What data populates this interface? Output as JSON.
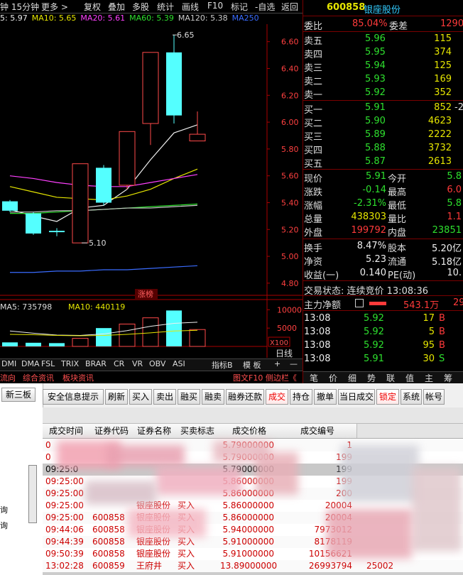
{
  "toolbar": {
    "period": "钟 15分钟",
    "more": "更多 >",
    "buttons": [
      "复权",
      "叠加",
      "多股",
      "统计",
      "画线",
      "F10",
      "标记",
      "-自选",
      "返回"
    ]
  },
  "ma_legend": {
    "ma5": "5: 5.97",
    "ma10": "MA10: 5.65",
    "ma20": "MA20: 5.61",
    "ma60": "MA60: 5.39",
    "ma120": "MA120: 5.38",
    "ma250": "MA250"
  },
  "chart_data": {
    "type": "candlestick",
    "y_ticks": [
      "6.60",
      "6.40",
      "6.20",
      "6.00",
      "5.80",
      "5.60",
      "5.40",
      "5.20",
      "5.00",
      "4.80"
    ],
    "ylim": [
      4.72,
      6.72
    ],
    "annotations": {
      "high": "6.65",
      "low": "5.10",
      "label": "涨榜"
    },
    "candles": [
      {
        "open": 5.34,
        "close": 5.41,
        "high": 5.42,
        "low": 5.33,
        "dir": "down"
      },
      {
        "open": 5.32,
        "close": 5.17,
        "high": 5.33,
        "low": 5.16,
        "dir": "down"
      },
      {
        "open": 5.19,
        "close": 5.18,
        "high": 5.21,
        "low": 5.15,
        "dir": "down"
      },
      {
        "open": 5.1,
        "close": 5.69,
        "high": 5.69,
        "low": 5.1,
        "dir": "up"
      },
      {
        "open": 5.66,
        "close": 5.4,
        "high": 5.68,
        "low": 5.38,
        "dir": "down"
      },
      {
        "open": 5.53,
        "close": 5.93,
        "high": 5.93,
        "low": 5.5,
        "dir": "up"
      },
      {
        "open": 5.99,
        "close": 6.52,
        "high": 6.52,
        "low": 5.83,
        "dir": "up"
      },
      {
        "open": 6.52,
        "close": 6.05,
        "high": 6.65,
        "low": 5.99,
        "dir": "down"
      },
      {
        "open": 5.86,
        "close": 5.91,
        "high": 6.08,
        "low": 5.86,
        "dir": "up"
      }
    ],
    "volume": {
      "legend_ma5": "MA5: 735798",
      "legend_ma10": "MA10: 440119",
      "y_ticks": [
        "10000",
        "5000"
      ],
      "unit": "X100",
      "values": [
        1100,
        1000,
        900,
        2200,
        5000,
        6100,
        7800,
        9800,
        4600
      ],
      "ylim": [
        0,
        12000
      ]
    }
  },
  "chart_tabs": {
    "indicators": [
      "DMI",
      "DMA",
      "FSL",
      "TRIX",
      "BRAR",
      "CR",
      "VR",
      "OBV",
      "ASI"
    ],
    "extras": [
      "指标B",
      "模 板",
      "+",
      "—"
    ],
    "right_label": "日线",
    "row2": [
      "流向",
      "综合资讯",
      "板块资讯"
    ],
    "row2_right": "图文F10 侧边栏《"
  },
  "quote": {
    "code": "600858",
    "name": "银座股份",
    "weibi_label": "委比",
    "weibi_value": "85.04%",
    "weicha_label": "委差",
    "weicha_value": "1290",
    "asks": [
      {
        "label": "卖五",
        "price": "5.96",
        "vol": "115"
      },
      {
        "label": "卖四",
        "price": "5.95",
        "vol": "374"
      },
      {
        "label": "卖三",
        "price": "5.94",
        "vol": "125"
      },
      {
        "label": "卖二",
        "price": "5.93",
        "vol": "169"
      },
      {
        "label": "卖一",
        "price": "5.92",
        "vol": "352"
      }
    ],
    "bids": [
      {
        "label": "买一",
        "price": "5.91",
        "vol": "852",
        "extra": "-2"
      },
      {
        "label": "买二",
        "price": "5.90",
        "vol": "4623"
      },
      {
        "label": "买三",
        "price": "5.89",
        "vol": "2222"
      },
      {
        "label": "买四",
        "price": "5.88",
        "vol": "3732"
      },
      {
        "label": "买五",
        "price": "5.87",
        "vol": "2613"
      }
    ],
    "stats": [
      {
        "l1": "现价",
        "v1": "5.91",
        "l2": "今开",
        "v2": "5.8"
      },
      {
        "l1": "涨跌",
        "v1": "-0.14",
        "l2": "最高",
        "v2": "6.0"
      },
      {
        "l1": "涨幅",
        "v1": "-2.31%",
        "l2": "最低",
        "v2": "5.8"
      },
      {
        "l1": "总量",
        "v1": "438303",
        "l2": "量比",
        "v2": "1.1"
      },
      {
        "l1": "外盘",
        "v1": "199792",
        "l2": "内盘",
        "v2": "23851"
      }
    ],
    "stats2": [
      {
        "l1": "换手",
        "v1": "8.47%",
        "l2": "股本",
        "v2": "5.20亿"
      },
      {
        "l1": "净资",
        "v1": "5.23",
        "l2": "流通",
        "v2": "5.18亿"
      },
      {
        "l1": "收益(一)",
        "v1": "0.140",
        "l2": "PE(动)",
        "v2": "10."
      }
    ],
    "trade_status": "交易状态: 连续竞价 13:08:36",
    "main_flow_label": "主力净额",
    "main_flow_value": "543.1万",
    "main_flow_extra": "29",
    "ticks": [
      {
        "time": "13:08",
        "price": "5.92",
        "vol": "17",
        "side": "B"
      },
      {
        "time": "13:08",
        "price": "5.92",
        "vol": "5",
        "side": "B"
      },
      {
        "time": "13:08",
        "price": "5.92",
        "vol": "95",
        "side": "B"
      },
      {
        "time": "13:08",
        "price": "5.91",
        "vol": "30",
        "side": "S"
      }
    ],
    "bottom_tabs": [
      "笔",
      "价",
      "细",
      "势",
      "联",
      "值",
      "主",
      "筹"
    ]
  },
  "trade": {
    "left_label": "新三板",
    "left_items": [
      "询",
      "询"
    ],
    "buttons": [
      "安全信息提示",
      "刷新",
      "买入",
      "卖出",
      "融买",
      "融卖",
      "融券还款",
      "成交",
      "持仓",
      "撤单",
      "当日成交",
      "锁定",
      "系统",
      "帐号"
    ],
    "columns": [
      "成交时间",
      "证券代码",
      "证券名称",
      "买卖标志",
      "成交价格",
      "成交编号"
    ],
    "rows": [
      {
        "time": "0",
        "code": "",
        "name": "",
        "side": "",
        "price": "5.79000000",
        "no": "1"
      },
      {
        "time": "0",
        "code": "",
        "name": "",
        "side": "",
        "price": "5.79000000",
        "no": "199"
      },
      {
        "time": "09:25:0",
        "code": "",
        "name": "",
        "side": "",
        "price": "5.79000000",
        "no": "199"
      },
      {
        "time": "09:25:00",
        "code": "",
        "name": "",
        "side": "",
        "price": "5.86000000",
        "no": "199"
      },
      {
        "time": "09:25:00",
        "code": "",
        "name": "",
        "side": "",
        "price": "5.86000000",
        "no": "200"
      },
      {
        "time": "09:25:00",
        "code": "",
        "name": "银座股份",
        "side": "买入",
        "price": "5.86000000",
        "no": "20004"
      },
      {
        "time": "09:25:00",
        "code": "600858",
        "name": "银座股份",
        "side": "买入",
        "price": "5.86000000",
        "no": "20004"
      },
      {
        "time": "09:44:06",
        "code": "600858",
        "name": "银座股份",
        "side": "买入",
        "price": "5.94000000",
        "no": "7973012"
      },
      {
        "time": "09:44:39",
        "code": "600858",
        "name": "银座股份",
        "side": "买入",
        "price": "5.91000000",
        "no": "8178119"
      },
      {
        "time": "09:50:39",
        "code": "600858",
        "name": "银座股份",
        "side": "买入",
        "price": "5.91000000",
        "no": "10156621"
      },
      {
        "time": "13:02:28",
        "code": "600859",
        "name": "王府井",
        "side": "买入",
        "price": "13.89000000",
        "no": "26993794"
      }
    ],
    "row_extra": "25002"
  }
}
